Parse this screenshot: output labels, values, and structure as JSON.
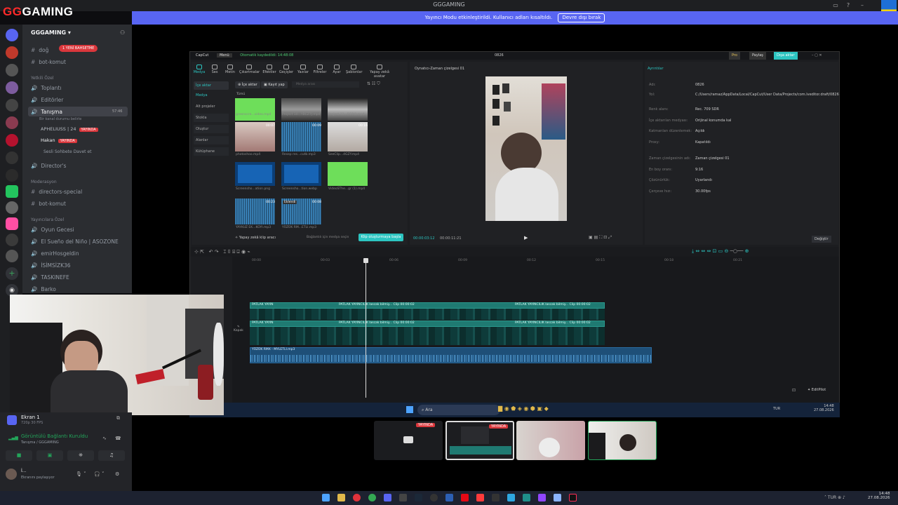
{
  "window": {
    "title": "GGGAMING",
    "brand_prefix": "GG",
    "brand_suffix": "GAMING"
  },
  "notice": {
    "text": "Yayıncı Modu etkinleştirildi. Kullanıcı adları kısaltıldı.",
    "button": "Devre dışı bırak"
  },
  "server": {
    "name": "GGGAMING"
  },
  "channels": {
    "badge": "1 YENİ BAHSETME",
    "top": [
      {
        "label": "doğ"
      },
      {
        "label": "bot-komut"
      }
    ],
    "cat_private": "Yetkili Özel",
    "private": [
      {
        "label": "Toplantı"
      },
      {
        "label": "Editörler"
      },
      {
        "label": "Tanışma"
      }
    ],
    "tanisma_time": "57:46",
    "status_line": "Bir kanal durumu belirle",
    "voice_users": [
      {
        "name": "APHELIUSS | 24",
        "badge": "YAYINDA"
      },
      {
        "name": "Hakan",
        "badge": "YAYINDA"
      }
    ],
    "invite": "Sesli Sohbete Davet et",
    "directors": "Director's",
    "cat_mod": "Moderasyon",
    "mod": [
      {
        "label": "directors-special"
      },
      {
        "label": "bot-komut"
      }
    ],
    "cat_streamers": "Yayıncılara Özel",
    "streamers": [
      {
        "label": "Oyun Gecesi"
      },
      {
        "label": "El Sueño del Niño | ASOZONE"
      },
      {
        "label": "emirHosgeldin"
      },
      {
        "label": "İSİMSİZK36"
      },
      {
        "label": "TASKINEFE"
      },
      {
        "label": "Barko"
      }
    ]
  },
  "voice_panel": {
    "screen_name": "Ekran 1",
    "screen_sub": "720p 30 FPS",
    "status": "Görüntülü Bağlantı Kuruldu",
    "channel": "Tanışma / GGGAMING",
    "user": "İ...",
    "user_sub": "Ekranını paylaşıyor"
  },
  "capcut": {
    "app": "CapCut",
    "menu": "Menü",
    "autosave": "Otomatik kaydedildi: 14:48:08",
    "project": "0826",
    "top_right": [
      "Pro",
      "Paylaş",
      "Dışa aktar"
    ],
    "tools": [
      "Medya",
      "Ses",
      "Metin",
      "Çıkartmalar",
      "Efektler",
      "Geçişler",
      "Yazılar",
      "Filtreler",
      "Ayar",
      "Şablonlar",
      "Yapay zekâ avatar"
    ],
    "side": [
      "İçe aktar",
      "Medya",
      "Alt projeler",
      "Stokla",
      "Oluştur",
      "Alanlar",
      "Kütüphane"
    ],
    "import_btn": "İçe aktar",
    "record_btn": "Kayıt yap",
    "search_placeholder": "Medya arası",
    "all_label": "Tümü",
    "media": [
      {
        "name": "greenscre...video.mp4",
        "dur": ""
      },
      {
        "name": "Project 10...YBCZ7J.mp4",
        "dur": ""
      },
      {
        "name": "Project 12...RORQ.mp4",
        "dur": ""
      },
      {
        "name": "photoshoo.mp4",
        "dur": "00:07"
      },
      {
        "name": "Resep res...cutb.mp3",
        "dur": "00:09"
      },
      {
        "name": "SeeClip...4GZY.mp4",
        "dur": "00:16"
      },
      {
        "name": "Screensho...ation.png",
        "dur": ""
      },
      {
        "name": "Screensho...tion.webp",
        "dur": ""
      },
      {
        "name": "VideoSThe...gr (1).mp4",
        "dur": ""
      },
      {
        "name": "YAYKUZ EK...KOYI.mp3",
        "dur": "00:23"
      },
      {
        "name": "YÜZÜK RM...ETLI.mp3",
        "dur": "00:08"
      }
    ],
    "added_label": "Eklendi",
    "ai_link": "Yapay zekâ klip aracı",
    "connect_text": "Bağlantılı için medya seçin",
    "create_btn": "Klip oluşturmaya başla",
    "player_title": "Oynatıcı-Zaman çizelgesi 01",
    "time_current": "00:00:03:12",
    "time_total": "00:00:11:21",
    "details_title": "Ayrıntılar",
    "details": [
      {
        "k": "Adı:",
        "v": "0826"
      },
      {
        "k": "Yol:",
        "v": "C:/Users/ramaz/AppData/Local/CapCut/User Data/Projects/com.lveditor.draft/0826"
      },
      {
        "k": "Renk alanı:",
        "v": "Rec. 709 SDR"
      },
      {
        "k": "İçe aktarılan medyası:",
        "v": "Orijinal konumda kal"
      },
      {
        "k": "Katmanları düzenlemek:",
        "v": "Açıldı"
      },
      {
        "k": "Proxy:",
        "v": "Kapatıldı"
      },
      {
        "k": "Zaman çizelgesinin adı:",
        "v": "Zaman çizelgesi 01"
      },
      {
        "k": "En boy oranı:",
        "v": "9:16"
      },
      {
        "k": "Çözünürlük:",
        "v": "Uyarlandı"
      },
      {
        "k": "Çerçeve hızı:",
        "v": "30.00fps"
      }
    ],
    "change_btn": "Değiştir",
    "ruler": [
      "00:00",
      "00:03",
      "00:06",
      "00:09",
      "00:12",
      "00:15",
      "00:18",
      "00:21"
    ],
    "clip_label": "PATLAK YAYINCILIK lascak bilmiy... Clip 00:00:02",
    "clip_label_short": "PATLAK YAYIN",
    "audio_label": "YÜZÜK RMX - MYLETLI.mp3",
    "cover": "Kapak",
    "editpilot": "EditPilot",
    "inner_search": "Ara",
    "inner_time": "14:48",
    "inner_date": "27.08.2026",
    "inner_lang": "TUR"
  },
  "streams": [
    {
      "badge": "YAYINDA"
    },
    {
      "badge": "YAYINDA"
    }
  ],
  "taskbar": {
    "lang": "TUR",
    "time": "14:48",
    "date": "27.08.2026"
  }
}
